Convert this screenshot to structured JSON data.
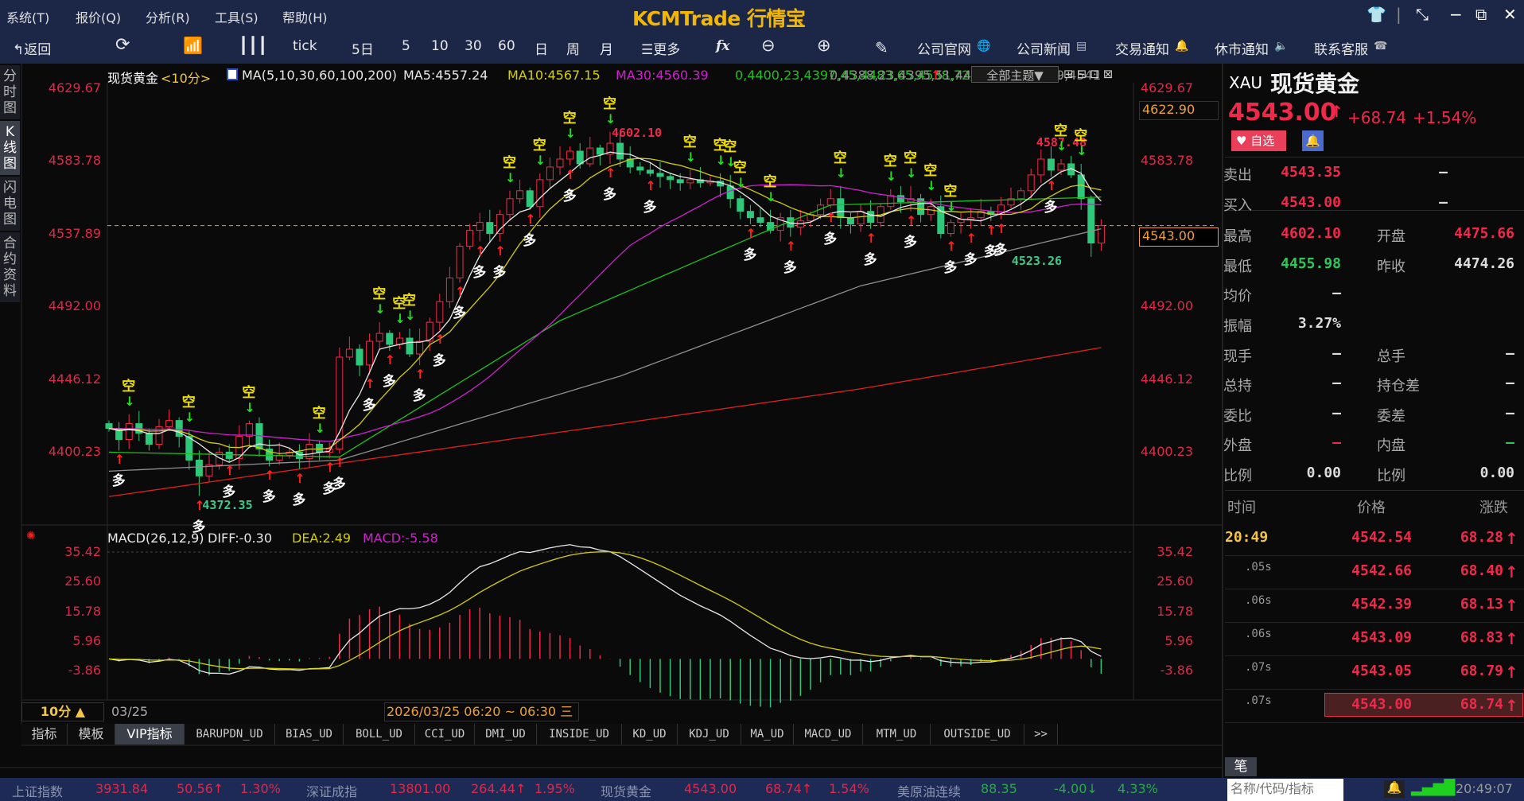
{
  "app": {
    "title": "KCMTrade 行情宝",
    "menu": [
      "系统(T)",
      "报价(Q)",
      "分析(R)",
      "工具(S)",
      "帮助(H)"
    ]
  },
  "toolbar": {
    "back": "返回",
    "periods": [
      "tick",
      "5日",
      "5",
      "10",
      "30",
      "60",
      "日",
      "周",
      "月"
    ],
    "more": "更多",
    "fx": "fx",
    "links": [
      "公司官网",
      "公司新闻",
      "交易通知",
      "休市通知",
      "联系客服"
    ]
  },
  "left_tabs": [
    "分时图",
    "K线图",
    "闪电图",
    "合约资料"
  ],
  "chart": {
    "symbol": "现货黄金",
    "period": "<10分>",
    "ma_label": "MA(5,10,30,60,100,200)",
    "ma5": "MA5:4557.24",
    "ma10": "MA10:4567.15",
    "ma30": "MA30:4560.39",
    "ma60": [
      [
        0,
        4400
      ],
      [
        23,
        4397
      ],
      [
        45,
        4483
      ],
      [
        65,
        4538
      ],
      [
        72,
        4556
      ],
      [
        99,
        4561
      ]
    ],
    "ma100": [
      [
        0,
        4388
      ],
      [
        23,
        4395
      ],
      [
        51,
        4448
      ],
      [
        75,
        4505
      ],
      [
        99,
        4541
      ]
    ],
    "theme_select": "全部主题▼",
    "y_ticks": [
      "4629.67",
      "4583.78",
      "4537.89",
      "4492.00",
      "4446.12",
      "4400.23"
    ],
    "y_values": [
      4629.67,
      4583.78,
      4537.89,
      4492.0,
      4446.12,
      4400.23
    ],
    "top_box": "4622.90",
    "last_box": "4543.00",
    "last_price": 4543.0,
    "high_label": "4602.10",
    "low_label": "4372.35",
    "recent_low_label": "4523.26",
    "recent_high_label": "4587.48",
    "short_text": "空",
    "long_text": "多",
    "closes": [
      4415,
      4408,
      4418,
      4412,
      4405,
      4416,
      4420,
      4410,
      4395,
      4385,
      4392,
      4400,
      4396,
      4410,
      4418,
      4402,
      4395,
      4398,
      4400,
      4396,
      4405,
      4400,
      4402,
      4460,
      4465,
      4455,
      4470,
      4475,
      4468,
      4472,
      4462,
      4470,
      4482,
      4495,
      4510,
      4530,
      4540,
      4545,
      4538,
      4550,
      4560,
      4565,
      4555,
      4572,
      4580,
      4585,
      4590,
      4582,
      4592,
      4588,
      4595,
      4585,
      4580,
      4578,
      4576,
      4574,
      4572,
      4570,
      4572,
      4570,
      4571,
      4568,
      4560,
      4552,
      4548,
      4545,
      4540,
      4548,
      4542,
      4546,
      4550,
      4556,
      4560,
      4548,
      4544,
      4552,
      4545,
      4555,
      4562,
      4558,
      4560,
      4550,
      4555,
      4538,
      4545,
      4547,
      4548,
      4552,
      4550,
      4556,
      4560,
      4565,
      4575,
      4585,
      4578,
      4582,
      4575,
      4560,
      4532,
      4543
    ],
    "ma200": [
      [
        0,
        4372
      ],
      [
        23,
        4393
      ],
      [
        51,
        4418
      ],
      [
        75,
        4440
      ],
      [
        99,
        4466
      ]
    ],
    "short_signals": [
      2,
      8,
      14,
      21,
      27,
      29,
      30,
      40,
      43,
      46,
      50,
      58,
      61,
      62,
      63,
      66,
      73,
      78,
      80,
      82,
      84,
      95,
      97
    ],
    "long_signals": [
      1,
      9,
      12,
      16,
      19,
      22,
      23,
      26,
      28,
      31,
      33,
      35,
      37,
      39,
      42,
      46,
      50,
      54,
      64,
      68,
      72,
      76,
      80,
      84,
      86,
      88,
      89,
      94
    ]
  },
  "macd": {
    "label": "MACD(26,12,9)",
    "diff": "DIFF:-0.30",
    "dea": "DEA:2.49",
    "macd": "MACD:-5.58",
    "y_ticks": [
      "35.42",
      "25.60",
      "15.78",
      "5.96",
      "-3.86"
    ],
    "y_values": [
      35.42,
      25.6,
      15.78,
      5.96,
      -3.86
    ]
  },
  "datebar": {
    "period": "10分 ▲",
    "date": "03/25",
    "range": "2026/03/25 06:20 ~ 06:30 三"
  },
  "indicator_tabs": [
    "指标",
    "模板",
    "VIP指标",
    "BARUPDN_UD",
    "BIAS_UD",
    "BOLL_UD",
    "CCI_UD",
    "DMI_UD",
    "INSIDE_UD",
    "KD_UD",
    "KDJ_UD",
    "MA_UD",
    "MACD_UD",
    "MTM_UD",
    "OUTSIDE_UD",
    ">>"
  ],
  "quote": {
    "code": "XAU",
    "name": "现货黄金",
    "price": "4543.00",
    "change": "+68.74",
    "pct": "+1.54%",
    "watch": "自选",
    "rows": [
      {
        "l1": "卖出",
        "v1": "4543.35",
        "c1": "red",
        "l2": "",
        "v2": "—",
        "c2": "white"
      },
      {
        "l1": "买入",
        "v1": "4543.00",
        "c1": "red",
        "l2": "",
        "v2": "—",
        "c2": "white"
      },
      {
        "l1": "最高",
        "v1": "4602.10",
        "c1": "red",
        "l2": "开盘",
        "v2": "4475.66",
        "c2": "red"
      },
      {
        "l1": "最低",
        "v1": "4455.98",
        "c1": "green",
        "l2": "昨收",
        "v2": "4474.26",
        "c2": "white"
      },
      {
        "l1": "均价",
        "v1": "—",
        "c1": "white",
        "l2": "",
        "v2": "",
        "c2": "white"
      },
      {
        "l1": "振幅",
        "v1": "3.27%",
        "c1": "white",
        "l2": "",
        "v2": "",
        "c2": "white"
      },
      {
        "l1": "现手",
        "v1": "—",
        "c1": "white",
        "l2": "总手",
        "v2": "—",
        "c2": "white"
      },
      {
        "l1": "总持",
        "v1": "—",
        "c1": "white",
        "l2": "持仓差",
        "v2": "—",
        "c2": "white"
      },
      {
        "l1": "委比",
        "v1": "—",
        "c1": "white",
        "l2": "委差",
        "v2": "—",
        "c2": "white"
      },
      {
        "l1": "外盘",
        "v1": "—",
        "c1": "red",
        "l2": "内盘",
        "v2": "—",
        "c2": "green"
      },
      {
        "l1": "比例",
        "v1": "0.00",
        "c1": "white",
        "l2": "比例",
        "v2": "0.00",
        "c2": "white"
      }
    ]
  },
  "ticks": {
    "headers": [
      "时间",
      "价格",
      "涨跌"
    ],
    "rows": [
      {
        "t": "20:49",
        "p": "4542.54",
        "c": "68.28"
      },
      {
        "t": ".05s",
        "p": "4542.66",
        "c": "68.40"
      },
      {
        "t": ".06s",
        "p": "4542.39",
        "c": "68.13"
      },
      {
        "t": ".06s",
        "p": "4543.09",
        "c": "68.83"
      },
      {
        "t": ".07s",
        "p": "4543.05",
        "c": "68.79"
      },
      {
        "t": ".07s",
        "p": "4543.00",
        "c": "68.74"
      }
    ],
    "tab": "笔"
  },
  "status": {
    "items": [
      {
        "name": "上证指数",
        "price": "3931.84",
        "chg": "50.56↑",
        "pct": "1.30%",
        "color": "#e0284a"
      },
      {
        "name": "深证成指",
        "price": "13801.00",
        "chg": "264.44↑",
        "pct": "1.95%",
        "color": "#e0284a"
      },
      {
        "name": "现货黄金",
        "price": "4543.00",
        "chg": "68.74↑",
        "pct": "1.54%",
        "color": "#e0284a"
      },
      {
        "name": "美原油连续",
        "price": "88.35",
        "chg": "-4.00↓",
        "pct": "4.33%",
        "color": "#2ea84a"
      }
    ],
    "search_placeholder": "名称/代码/指标",
    "time": "20:49:07"
  },
  "colors": {
    "up": "#f0294b",
    "down": "#2ec87a",
    "ma5": "#e8e8e8",
    "ma10": "#d4d000",
    "ma30": "#d020d0",
    "ma60": "#20c020",
    "ma100": "#909090",
    "ma200": "#e02020",
    "navy": "#1c2647"
  }
}
